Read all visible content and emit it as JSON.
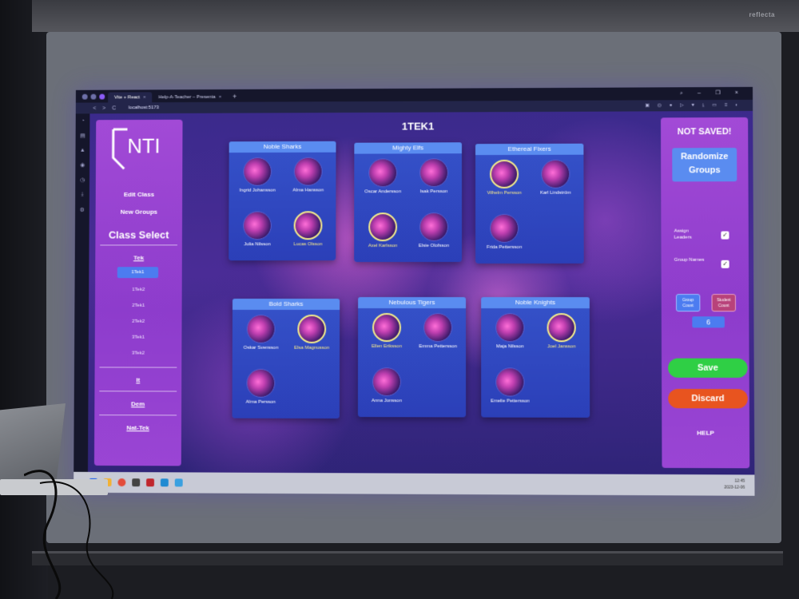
{
  "projector": {
    "brand": "reflecta"
  },
  "browser": {
    "tabs": [
      {
        "label": "Vite + React",
        "active": true
      },
      {
        "label": "Help-A-Teacher – Presenta",
        "active": false
      }
    ],
    "new_tab": "+",
    "url": "localhost:5173",
    "nav_back": "<",
    "nav_forward": ">",
    "nav_reload": "C"
  },
  "left_panel": {
    "logo_text": "NTI",
    "edit_class": "Edit Class",
    "new_groups": "New Groups",
    "class_select": "Class Select",
    "groups": [
      {
        "label": "Tek",
        "classes": [
          "1Tek1",
          "1Tek2",
          "2Tek1",
          "2Tek2",
          "3Tek1",
          "3Tek2"
        ],
        "selected": "1Tek1"
      },
      {
        "label": "It"
      },
      {
        "label": "Dem"
      },
      {
        "label": "Nat-Tek"
      }
    ]
  },
  "main": {
    "title": "1TEK1",
    "groups": [
      {
        "name": "Noble Sharks",
        "students": [
          {
            "name": "Ingrid Johansson",
            "leader": false
          },
          {
            "name": "Alma Hansson",
            "leader": false
          },
          {
            "name": "Julia Nilsson",
            "leader": false
          },
          {
            "name": "Lucas Olsson",
            "leader": true
          }
        ]
      },
      {
        "name": "Mighty Elfs",
        "students": [
          {
            "name": "Oscar Andersson",
            "leader": false
          },
          {
            "name": "Isak Persson",
            "leader": false
          },
          {
            "name": "Axel Karlsson",
            "leader": true
          },
          {
            "name": "Elsie Olofsson",
            "leader": false
          }
        ]
      },
      {
        "name": "Ethereal Fixers",
        "students": [
          {
            "name": "Vilhelm Persson",
            "leader": true
          },
          {
            "name": "Karl Lindström",
            "leader": false
          },
          {
            "name": "Frida Pettersson",
            "leader": false
          }
        ]
      },
      {
        "name": "Bold Sharks",
        "students": [
          {
            "name": "Oskar Svensson",
            "leader": false
          },
          {
            "name": "Elsa Magnusson",
            "leader": true
          },
          {
            "name": "Alma Persson",
            "leader": false
          }
        ]
      },
      {
        "name": "Nebulous Tigers",
        "students": [
          {
            "name": "Ellen Eriksson",
            "leader": true
          },
          {
            "name": "Emma Pettersson",
            "leader": false
          },
          {
            "name": "Anna Jonsson",
            "leader": false
          }
        ]
      },
      {
        "name": "Noble Knights",
        "students": [
          {
            "name": "Maja Nilsson",
            "leader": false
          },
          {
            "name": "Joel Jansson",
            "leader": true
          },
          {
            "name": "Emelie Pettersson",
            "leader": false
          }
        ]
      }
    ]
  },
  "right_panel": {
    "status": "NOT SAVED!",
    "randomize_line1": "Randomize",
    "randomize_line2": "Groups",
    "assign_leaders": "Assign Leaders",
    "assign_leaders_checked": true,
    "group_names": "Group Names",
    "group_names_checked": true,
    "group_count": "Group Count",
    "student_count": "Student Count",
    "count_value": "6",
    "save": "Save",
    "discard": "Discard",
    "help": "HELP"
  },
  "taskbar": {
    "time": "12:45",
    "date": "2023-12-06"
  },
  "colors": {
    "panel": "#9a45d4",
    "card": "#3552c9",
    "card_header": "#5a8cf0",
    "save": "#2fcf45",
    "discard": "#e8541f",
    "leader_ring": "#f4ec8c"
  }
}
